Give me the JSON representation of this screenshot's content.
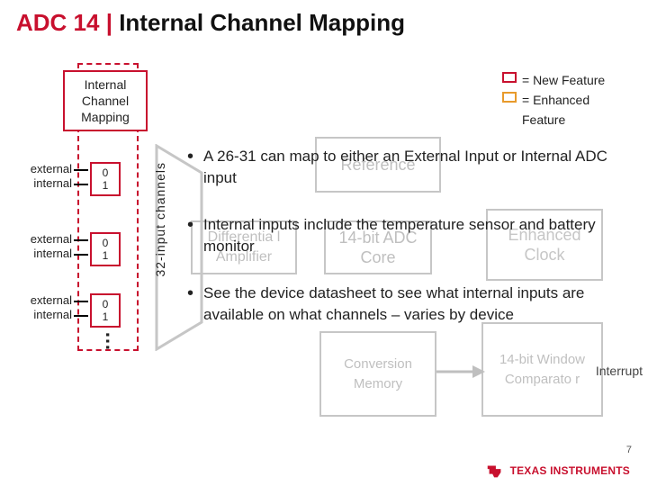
{
  "title": {
    "prefix": "ADC 14 | ",
    "main": "Internal Channel Mapping"
  },
  "legend": {
    "new": "= New Feature",
    "enhanced": "= Enhanced Feature"
  },
  "icm_box": "Internal Channel Mapping",
  "mux_labels": {
    "top": "0",
    "bot": "1"
  },
  "io": {
    "ext": "external",
    "int": "internal"
  },
  "vlabel": "32-input channels",
  "dots": "…",
  "bg": {
    "reference": "Reference",
    "diffamp": "Differentia l Amplifier",
    "adccore": "14-bit ADC Core",
    "clock": "Enhanced Clock",
    "memory": "Conversion Memory",
    "comparator": "14-bit Window Comparato r"
  },
  "bullets": [
    "A 26-31 can map to either an External Input or Internal ADC input",
    "Internal inputs include the temperature sensor and battery monitor",
    "See the device datasheet to see what internal inputs are available on what channels – varies by device"
  ],
  "interrupt": "Interrupt",
  "page": "7",
  "logo": "TEXAS INSTRUMENTS"
}
